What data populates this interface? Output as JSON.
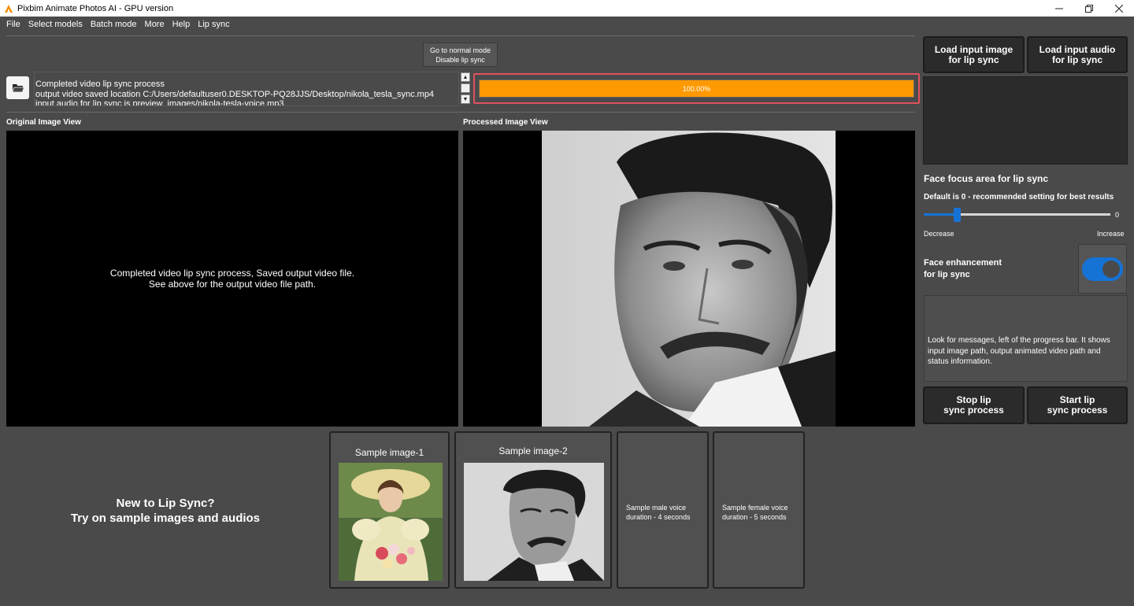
{
  "window": {
    "title": "Pixbim Animate Photos AI - GPU version"
  },
  "menu": [
    "File",
    "Select models",
    "Batch mode",
    "More",
    "Help",
    "Lip sync"
  ],
  "mode_button": {
    "line1": "Go to normal mode",
    "line2": "Disable lip sync"
  },
  "log": {
    "line1": "Completed video lip sync process",
    "line2": "output video saved location C:/Users/defaultuser0.DESKTOP-PQ28JJS/Desktop/nikola_tesla_sync.mp4",
    "line3": "input audio for lip sync is preview_images/nikola-tesla-voice.mp3"
  },
  "progress": {
    "value": 1.0,
    "label": "100.00%"
  },
  "views": {
    "original_label": "Original Image View",
    "processed_label": "Processed Image View",
    "original_msg_line1": "Completed video lip sync process, Saved output video file.",
    "original_msg_line2": "See above for the output video file path."
  },
  "right_panel": {
    "load_image_line1": "Load input image",
    "load_image_line2": "for lip sync",
    "load_audio_line1": "Load input audio",
    "load_audio_line2": "for lip sync",
    "face_focus_title": "Face focus area for lip sync",
    "face_focus_hint": "Default is 0 - recommended setting for best results",
    "slider_value": "0",
    "decrease": "Decrease",
    "increase": "Increase",
    "face_enh_line1": "Face enhancement",
    "face_enh_line2": "for lip sync",
    "face_enh_on": true,
    "message": "Look for messages, left of the progress bar. It shows input image path, output animated video path and status information.",
    "stop_line1": "Stop lip",
    "stop_line2": "sync process",
    "start_line1": "Start lip",
    "start_line2": "sync process"
  },
  "promo": {
    "line1": "New to Lip Sync?",
    "line2": "Try on sample images and audios"
  },
  "samples": {
    "image1": "Sample image-1",
    "image2": "Sample image-2",
    "male_line1": "Sample male voice",
    "male_line2": "duration - 4 seconds",
    "female_line1": "Sample female voice",
    "female_line2": "duration - 5 seconds"
  },
  "colors": {
    "accent": "#1673d6",
    "progress": "#ff9900",
    "highlight": "#e0525e",
    "background": "#4a4a4a"
  }
}
